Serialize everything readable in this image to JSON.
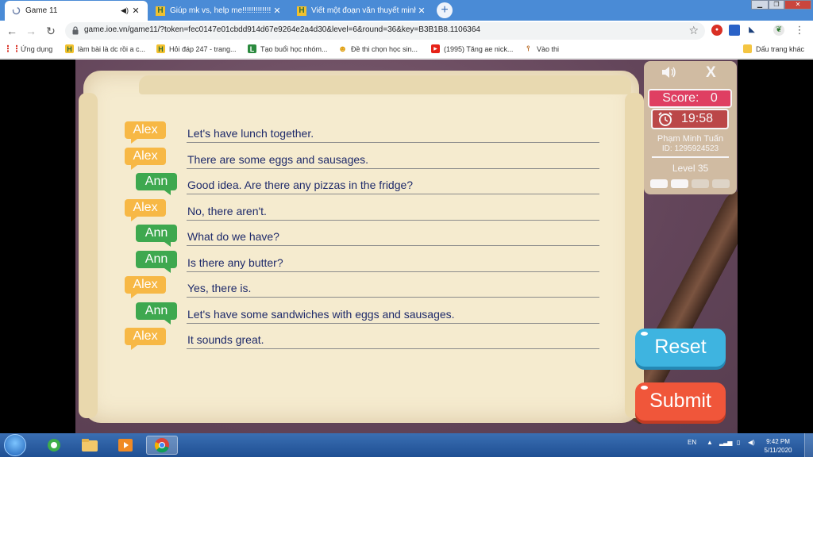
{
  "browser": {
    "tabs": [
      {
        "title": "Game 11",
        "active": true
      },
      {
        "title": "Giúp mk vs, help me!!!!!!!!!!!!!! Câ",
        "active": false
      },
      {
        "title": "Viết một đoạn văn thuyết minh v",
        "active": false
      }
    ],
    "new_tab_symbol": "+",
    "url": "game.ioe.vn/game11/?token=fec0147e01cbdd914d67e9264e2a4d30&level=6&round=36&key=B3B1B8.1106364",
    "bookmarks": [
      {
        "label": "Ứng dụng",
        "icon": "apps-grid-icon"
      },
      {
        "label": "làm bài là dc rồi a c...",
        "icon": "hoidap-h-icon"
      },
      {
        "label": "Hỏi đáp 247 - trang...",
        "icon": "hoidap-h-icon"
      },
      {
        "label": "Tạo buổi học nhóm...",
        "icon": "l-square-icon"
      },
      {
        "label": "Đề thi chọn học sin...",
        "icon": "emoji-icon"
      },
      {
        "label": "(1995) Tăng ae nick...",
        "icon": "youtube-icon"
      },
      {
        "label": "Vào thi",
        "icon": "pin-icon"
      }
    ],
    "other_bookmarks": "Dấu trang khác"
  },
  "game": {
    "dialogue": [
      {
        "speaker": "Alex",
        "text": "Let's have lunch together."
      },
      {
        "speaker": "Alex",
        "text": "There are some eggs and sausages."
      },
      {
        "speaker": "Ann",
        "text": "Good idea. Are there any pizzas in the fridge?"
      },
      {
        "speaker": "Alex",
        "text": "No, there aren't."
      },
      {
        "speaker": "Ann",
        "text": "What do we have?"
      },
      {
        "speaker": "Ann",
        "text": "Is there any butter?"
      },
      {
        "speaker": "Alex",
        "text": "Yes, there is."
      },
      {
        "speaker": "Ann",
        "text": "Let's have some sandwiches with eggs and sausages."
      },
      {
        "speaker": "Alex",
        "text": "It sounds great."
      }
    ],
    "hud": {
      "close_symbol": "X",
      "score_label": "Score:",
      "score_value": "0",
      "timer": "19:58",
      "player_name": "Phạm Minh Tuấn",
      "player_id": "ID: 1295924523",
      "level": "Level 35",
      "progress_total": 4,
      "progress_done": 2
    },
    "reset_label": "Reset",
    "submit_label": "Submit",
    "colors": {
      "alex": "#f7b845",
      "ann": "#3ea84f",
      "score": "#e63f63",
      "reset": "#3eb4e0",
      "submit": "#f0563a"
    }
  },
  "taskbar": {
    "language": "EN",
    "time": "9:42 PM",
    "date": "5/11/2020"
  }
}
